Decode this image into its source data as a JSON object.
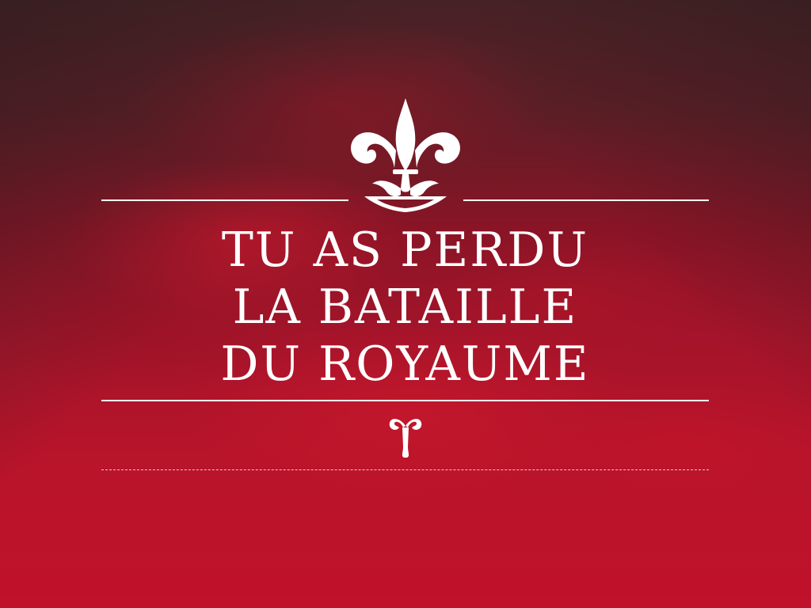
{
  "screen": {
    "name": "defeat-screen",
    "colors": {
      "background_top": "#4a2226",
      "background_bottom": "#c0122a",
      "text": "#ffffff",
      "rules": "#ffffff"
    }
  },
  "emblem": {
    "icon": "fleur-de-lis-icon"
  },
  "title": {
    "lines": [
      "TU AS PERDU",
      "LA BATAILLE",
      "DU ROYAUME"
    ]
  },
  "ornament": {
    "icon": "ornament-icon"
  }
}
